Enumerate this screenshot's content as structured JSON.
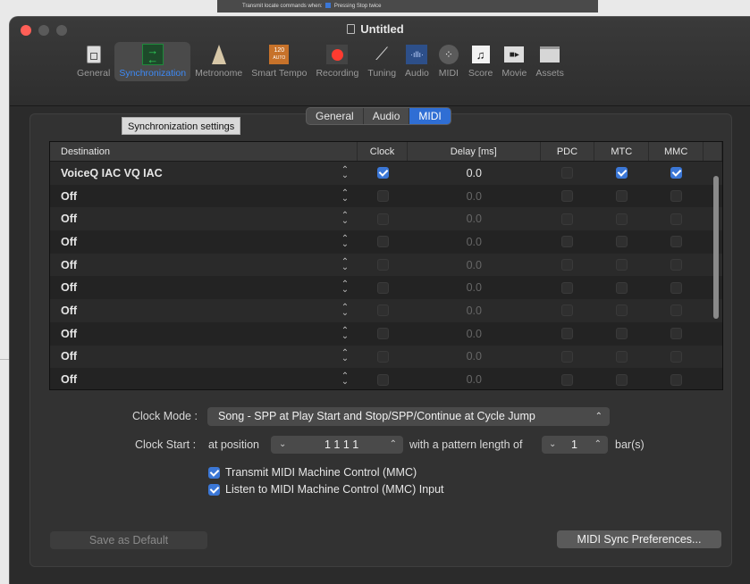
{
  "background": {
    "strip_label": "Transmit locate commands when:",
    "strip_option": "Pressing Stop twice"
  },
  "window": {
    "title": "Untitled"
  },
  "toolbar": {
    "items": [
      {
        "label": "General",
        "icon": "general-icon"
      },
      {
        "label": "Synchronization",
        "icon": "synchronization-icon",
        "active": true
      },
      {
        "label": "Metronome",
        "icon": "metronome-icon"
      },
      {
        "label": "Smart Tempo",
        "icon": "smart-tempo-icon",
        "badge_top": "120",
        "badge_bottom": "AUTO"
      },
      {
        "label": "Recording",
        "icon": "record-icon"
      },
      {
        "label": "Tuning",
        "icon": "tuning-fork-icon"
      },
      {
        "label": "Audio",
        "icon": "audio-waveform-icon"
      },
      {
        "label": "MIDI",
        "icon": "midi-port-icon"
      },
      {
        "label": "Score",
        "icon": "score-note-icon"
      },
      {
        "label": "Movie",
        "icon": "movie-camera-icon"
      },
      {
        "label": "Assets",
        "icon": "assets-box-icon"
      }
    ]
  },
  "tooltip": {
    "text": "Synchronization settings"
  },
  "tabs": [
    {
      "label": "General"
    },
    {
      "label": "Audio"
    },
    {
      "label": "MIDI",
      "selected": true
    }
  ],
  "table": {
    "headers": {
      "destination": "Destination",
      "clock": "Clock",
      "delay": "Delay [ms]",
      "pdc": "PDC",
      "mtc": "MTC",
      "mmc": "MMC"
    },
    "rows": [
      {
        "destination": "VoiceQ IAC VQ IAC",
        "clock": true,
        "delay": "0.0",
        "pdc": false,
        "mtc": true,
        "mmc": true,
        "active": true
      },
      {
        "destination": "Off",
        "clock": false,
        "delay": "0.0",
        "pdc": false,
        "mtc": false,
        "mmc": false,
        "active": false
      },
      {
        "destination": "Off",
        "clock": false,
        "delay": "0.0",
        "pdc": false,
        "mtc": false,
        "mmc": false,
        "active": false
      },
      {
        "destination": "Off",
        "clock": false,
        "delay": "0.0",
        "pdc": false,
        "mtc": false,
        "mmc": false,
        "active": false
      },
      {
        "destination": "Off",
        "clock": false,
        "delay": "0.0",
        "pdc": false,
        "mtc": false,
        "mmc": false,
        "active": false
      },
      {
        "destination": "Off",
        "clock": false,
        "delay": "0.0",
        "pdc": false,
        "mtc": false,
        "mmc": false,
        "active": false
      },
      {
        "destination": "Off",
        "clock": false,
        "delay": "0.0",
        "pdc": false,
        "mtc": false,
        "mmc": false,
        "active": false
      },
      {
        "destination": "Off",
        "clock": false,
        "delay": "0.0",
        "pdc": false,
        "mtc": false,
        "mmc": false,
        "active": false
      },
      {
        "destination": "Off",
        "clock": false,
        "delay": "0.0",
        "pdc": false,
        "mtc": false,
        "mmc": false,
        "active": false
      },
      {
        "destination": "Off",
        "clock": false,
        "delay": "0.0",
        "pdc": false,
        "mtc": false,
        "mmc": false,
        "active": false
      }
    ]
  },
  "clock_mode": {
    "label": "Clock Mode :",
    "value": "Song - SPP at Play Start and Stop/SPP/Continue at Cycle Jump"
  },
  "clock_start": {
    "label": "Clock Start :",
    "at_position": "at position",
    "position_value": "1  1  1     1",
    "pattern_label": "with a pattern length of",
    "pattern_value": "1",
    "unit": "bar(s)"
  },
  "options": [
    {
      "label": "Transmit MIDI Machine Control (MMC)",
      "checked": true
    },
    {
      "label": "Listen to MIDI Machine Control (MMC) Input",
      "checked": true
    }
  ],
  "buttons": {
    "save_default": "Save as Default",
    "midi_sync_prefs": "MIDI Sync Preferences..."
  },
  "colors": {
    "accent": "#3b77d6",
    "active_tab": "#2f6ed4",
    "sync_green": "#2ed158"
  }
}
